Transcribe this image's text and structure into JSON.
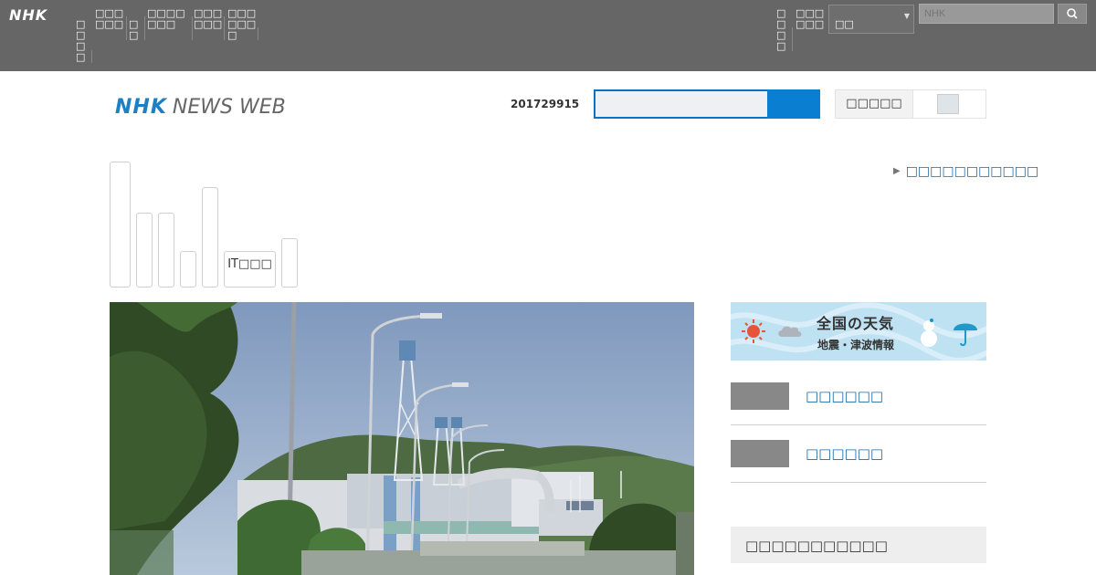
{
  "global": {
    "logo": "NHK",
    "nav": [
      {
        "label": "□□□□"
      },
      {
        "label": "□□□□□□"
      },
      {
        "label": "□□"
      },
      {
        "label": "□□□□□□□"
      },
      {
        "label": "□□□□□□"
      },
      {
        "label": "□□□□□□□"
      },
      {
        "label": "□□□□"
      },
      {
        "label": "□□□□□□"
      }
    ],
    "language_value": "□□",
    "search_placeholder": "NHK"
  },
  "header": {
    "logo_nhk": "NHK",
    "logo_newsweb": "NEWS WEB",
    "date": "201729915",
    "toggle_label": "□□□□□"
  },
  "categories": [
    {
      "label": ""
    },
    {
      "label": ""
    },
    {
      "label": ""
    },
    {
      "label": ""
    },
    {
      "label": ""
    },
    {
      "label": "IT□□□"
    },
    {
      "label": ""
    }
  ],
  "main": {
    "more_link": "□□□□□□□□□□□"
  },
  "sidebar": {
    "weather_title": "全国の天気",
    "weather_sub": "地震・津波情報",
    "items": [
      {
        "label": "□□□□□□"
      },
      {
        "label": "□□□□□□"
      }
    ],
    "box_label": "□□□□□□□□□□□"
  },
  "colors": {
    "brand_blue": "#0a7fd1",
    "link": "#1a6aa5",
    "topbar": "#666666"
  }
}
